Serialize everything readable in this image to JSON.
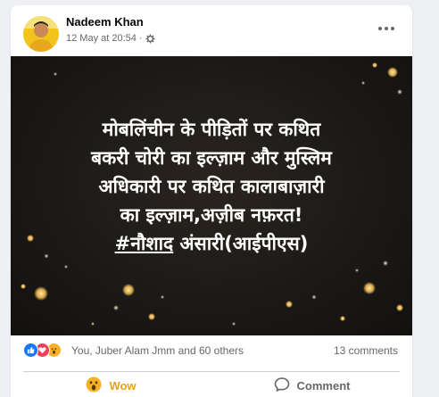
{
  "post": {
    "author_name": "Nadeem Khan",
    "timestamp": "12 May at 20:54",
    "separator": "·",
    "privacy_icon": "gear-icon",
    "more_icon": "more-options-icon"
  },
  "media": {
    "lines": [
      "मोबलिंचीन के पीड़ितों पर कथित",
      "बकरी चोरी का इल्ज़ाम और मुस्लिम",
      "अधिकारी पर कथित कालाबाज़ारी",
      "का इल्ज़ाम,अज़ीब नफ़रत!"
    ],
    "hashtag": "#नौशाद",
    "last_line_rest": " अंसारी(आईपीएस)"
  },
  "reactions": {
    "icons": [
      "like-icon",
      "love-icon",
      "wow-icon"
    ],
    "names": "You, Juber Alam Jmm and 60 others",
    "comments": "13 comments"
  },
  "actions": {
    "wow_label": "Wow",
    "comment_label": "Comment"
  },
  "colors": {
    "wow_active": "#e8a21c",
    "like_blue": "#1877f2",
    "love_red": "#f33e58",
    "wow_yellow": "#f7b125"
  }
}
